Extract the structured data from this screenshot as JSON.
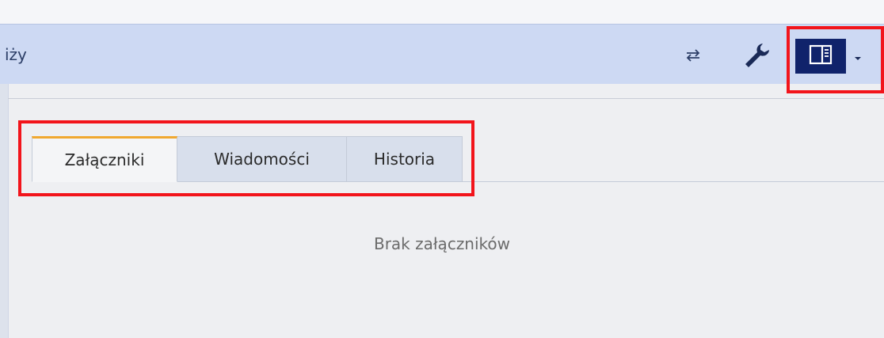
{
  "toolbar": {
    "label": "iży",
    "icons": {
      "swap": "swap-arrows-icon",
      "settings": "wrench-icon",
      "panel": "panel-layout-icon",
      "dropdown": "caret-down-icon"
    }
  },
  "tabs": [
    {
      "label": "Załączniki",
      "active": true
    },
    {
      "label": "Wiadomości",
      "active": false
    },
    {
      "label": "Historia",
      "active": false
    }
  ],
  "content": {
    "empty_message": "Brak załączników"
  },
  "colors": {
    "toolbar_bg": "#cdd9f3",
    "accent": "#10236b",
    "active_tab_indicator": "#f0a830",
    "highlight": "#f2141b"
  }
}
